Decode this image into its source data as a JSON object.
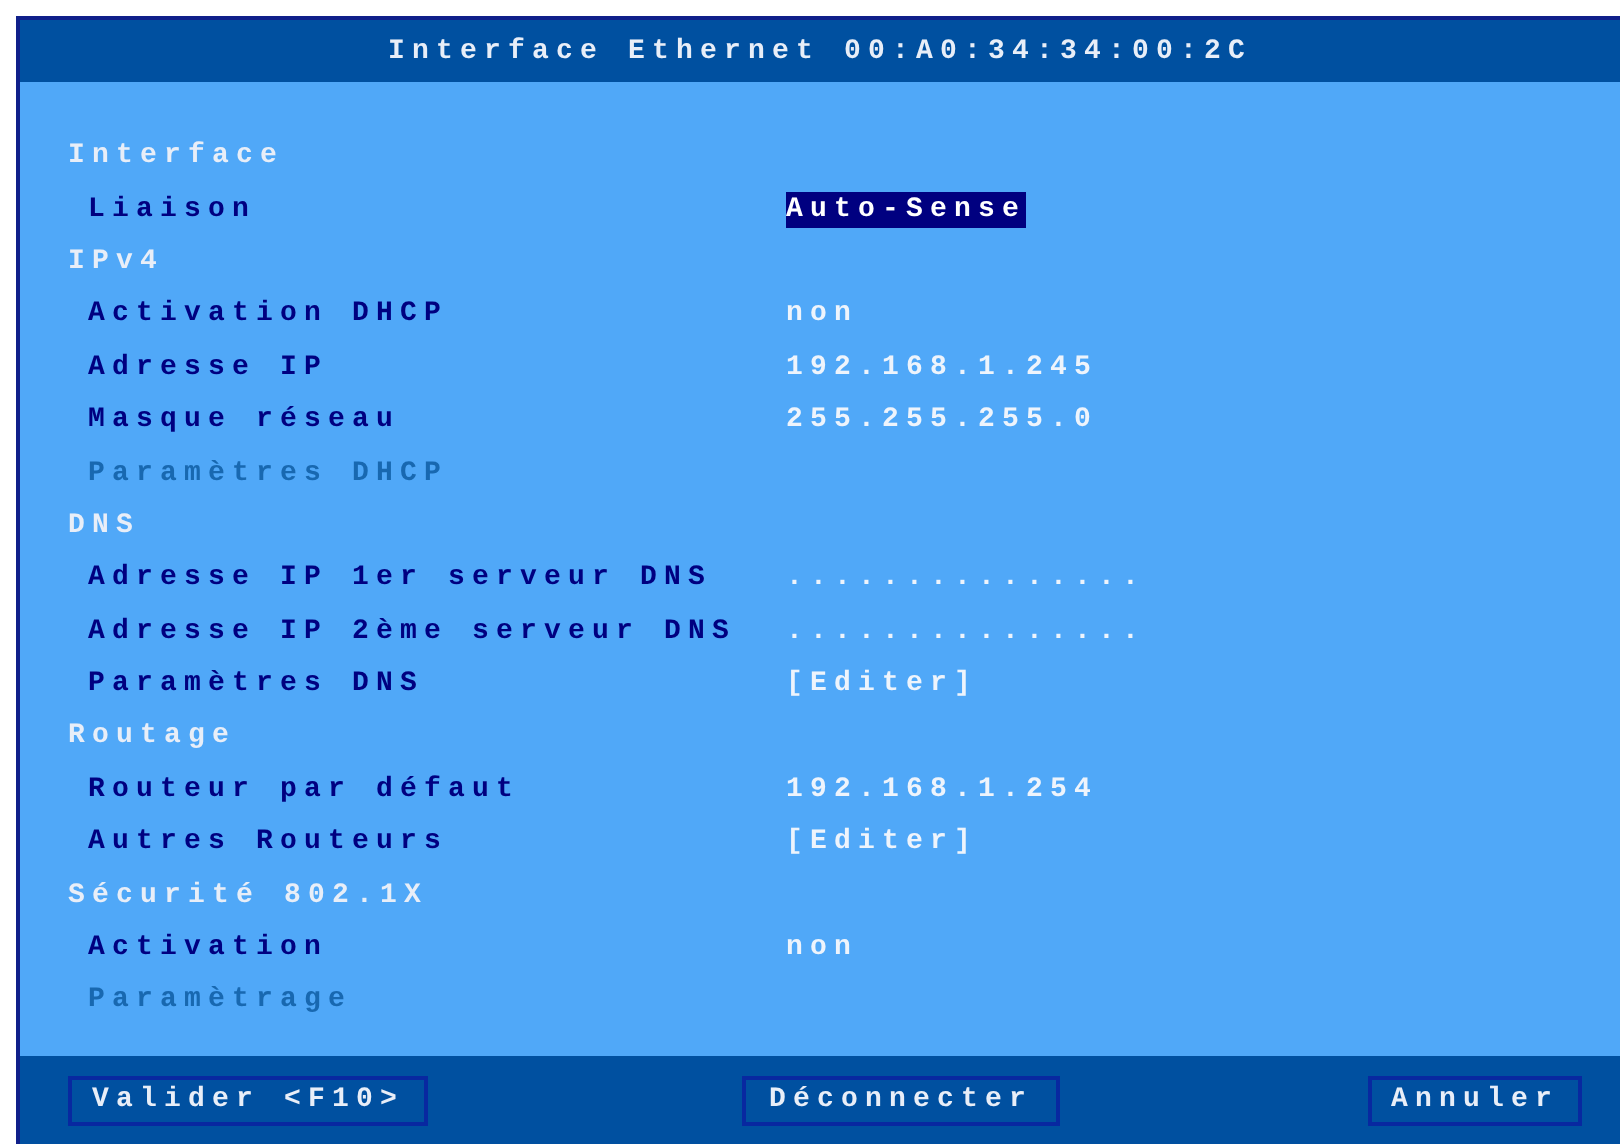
{
  "window": {
    "title": "Interface Ethernet 00:A0:34:34:00:2C"
  },
  "sections": [
    {
      "title": "Interface",
      "items": [
        {
          "label": "Liaison",
          "value": "Auto-Sense",
          "selected": true,
          "disabled": false
        }
      ]
    },
    {
      "title": "IPv4",
      "items": [
        {
          "label": "Activation DHCP",
          "value": "non",
          "selected": false,
          "disabled": false
        },
        {
          "label": "Adresse IP",
          "value": "192.168.1.245",
          "selected": false,
          "disabled": false
        },
        {
          "label": "Masque réseau",
          "value": "255.255.255.0",
          "selected": false,
          "disabled": false
        },
        {
          "label": "Paramètres DHCP",
          "disabled": true
        }
      ]
    },
    {
      "title": "DNS",
      "items": [
        {
          "label": "Adresse IP 1er serveur DNS",
          "value": "...............",
          "selected": false,
          "disabled": false
        },
        {
          "label": "Adresse IP 2ème serveur DNS",
          "value": "...............",
          "selected": false,
          "disabled": false
        },
        {
          "label": "Paramètres DNS",
          "value": "[Editer]",
          "selected": false,
          "disabled": false
        }
      ]
    },
    {
      "title": "Routage",
      "items": [
        {
          "label": "Routeur par défaut",
          "value": "192.168.1.254",
          "selected": false,
          "disabled": false
        },
        {
          "label": "Autres Routeurs",
          "value": "[Editer]",
          "selected": false,
          "disabled": false
        }
      ]
    },
    {
      "title": "Sécurité 802.1X",
      "items": [
        {
          "label": "Activation",
          "value": "non",
          "selected": false,
          "disabled": false
        },
        {
          "label": "Paramètrage",
          "disabled": true
        }
      ]
    }
  ],
  "buttons": [
    "Valider <F10>",
    "Déconnecter",
    "Annuler"
  ]
}
